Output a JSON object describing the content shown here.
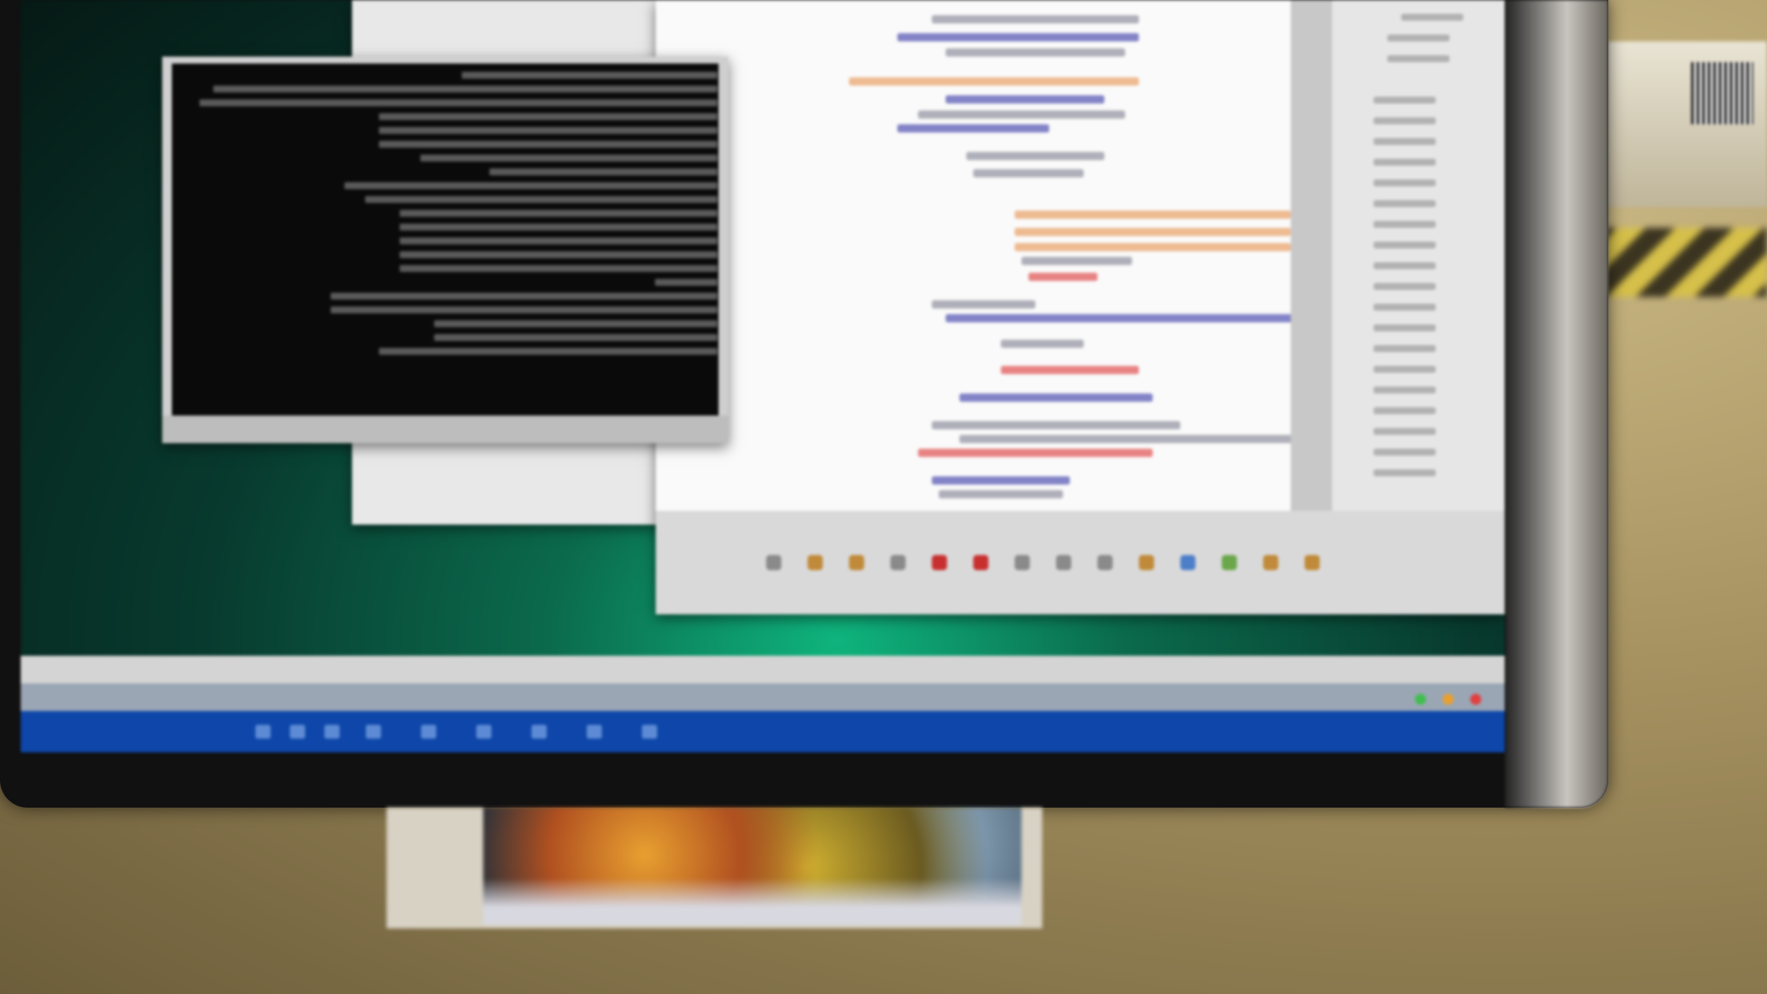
{
  "scene": {
    "description_visible": "",
    "monitor_title_bar": "",
    "status_bar_left": "",
    "status_bar_right": ""
  }
}
